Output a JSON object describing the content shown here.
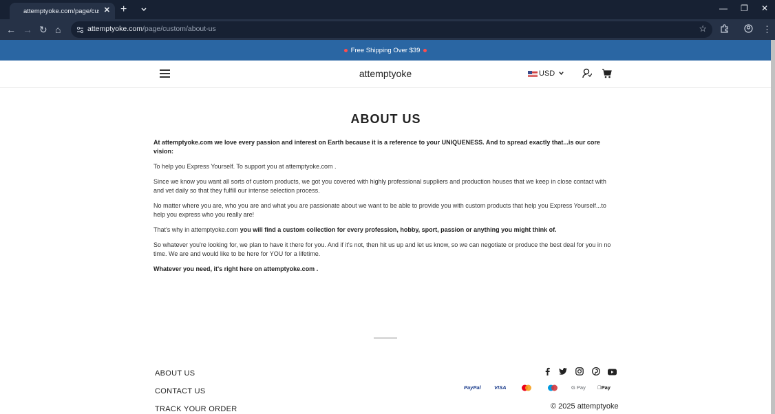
{
  "browser": {
    "tab_title": "attemptyoke.com/page/custom/about-us",
    "url_host": "attemptyoke.com",
    "url_path": "/page/custom/about-us"
  },
  "announcement": "Free Shipping Over $39",
  "header": {
    "logo": "attemptyoke",
    "currency": "USD"
  },
  "content": {
    "title": "ABOUT US",
    "p1_bold": "At attemptyoke.com  we love every passion and interest on Earth because it is a reference to your UNIQUENESS. And to spread exactly that...is our core vision:",
    "p2": "To help you Express Yourself. To support you at attemptyoke.com .",
    "p3": "Since we know you want all sorts of custom products, we got you covered with highly professional suppliers and production houses that we keep in close contact with and vet daily so that they fulfill our intense selection process.",
    "p4": "No matter where you are, who you are and what you are passionate about we want to be able to provide you with custom products that help you Express Yourself...to help you express who you really are!",
    "p5_normal": "That's why in attemptyoke.com ",
    "p5_bold": " you will find a custom collection for every profession, hobby, sport, passion or anything you might think of.",
    "p6": "So whatever you're looking for, we plan to have it there for you. And if it's not, then hit us up and let us know, so we can negotiate or produce the best deal for you in no time. We are and would like to be here for YOU for a lifetime.",
    "p7_bold": "Whatever you need, it's right here on attemptyoke.com ."
  },
  "footer": {
    "links": [
      "ABOUT US",
      "CONTACT US",
      "TRACK YOUR ORDER"
    ],
    "payments": [
      "PayPal",
      "VISA",
      "mastercard",
      "maestro",
      "G Pay",
      "Pay"
    ],
    "copyright": "© 2025 attemptyoke"
  },
  "colors": {
    "announcement_bg": "#2a66a3",
    "chrome_bg": "#172133"
  }
}
